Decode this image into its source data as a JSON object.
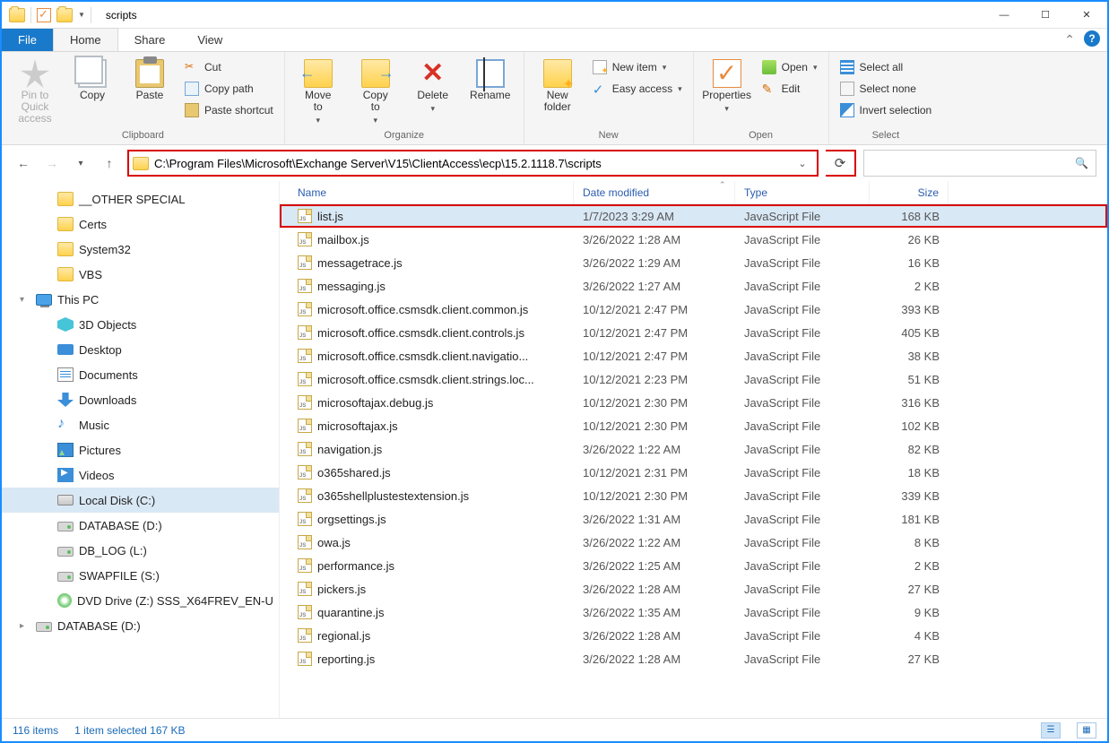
{
  "title": "scripts",
  "tabs": {
    "file": "File",
    "home": "Home",
    "share": "Share",
    "view": "View"
  },
  "ribbon": {
    "clipboard": {
      "label": "Clipboard",
      "pin": "Pin to Quick\naccess",
      "copy": "Copy",
      "paste": "Paste",
      "cut": "Cut",
      "copypath": "Copy path",
      "pasteshortcut": "Paste shortcut"
    },
    "organize": {
      "label": "Organize",
      "moveto": "Move\nto",
      "copyto": "Copy\nto",
      "delete": "Delete",
      "rename": "Rename"
    },
    "new_": {
      "label": "New",
      "newfolder": "New\nfolder",
      "newitem": "New item",
      "easyaccess": "Easy access"
    },
    "open": {
      "label": "Open",
      "properties": "Properties",
      "open": "Open",
      "edit": "Edit"
    },
    "select": {
      "label": "Select",
      "all": "Select all",
      "none": "Select none",
      "invert": "Invert selection"
    }
  },
  "address": "C:\\Program Files\\Microsoft\\Exchange Server\\V15\\ClientAccess\\ecp\\15.2.1118.7\\scripts",
  "tree": {
    "items": [
      {
        "kind": "folder",
        "lvl": 1,
        "label": "__OTHER SPECIAL"
      },
      {
        "kind": "folder",
        "lvl": 1,
        "label": "Certs"
      },
      {
        "kind": "folder",
        "lvl": 1,
        "label": "System32"
      },
      {
        "kind": "folder",
        "lvl": 1,
        "label": "VBS"
      },
      {
        "kind": "pc",
        "lvl": 0,
        "label": "This PC",
        "exp": "▾"
      },
      {
        "kind": "obj3d",
        "lvl": 1,
        "label": "3D Objects"
      },
      {
        "kind": "desktop",
        "lvl": 1,
        "label": "Desktop"
      },
      {
        "kind": "docs",
        "lvl": 1,
        "label": "Documents"
      },
      {
        "kind": "down",
        "lvl": 1,
        "label": "Downloads"
      },
      {
        "kind": "music",
        "lvl": 1,
        "label": "Music"
      },
      {
        "kind": "pics",
        "lvl": 1,
        "label": "Pictures"
      },
      {
        "kind": "vids",
        "lvl": 1,
        "label": "Videos"
      },
      {
        "kind": "hdd",
        "lvl": 1,
        "label": "Local Disk (C:)",
        "sel": true
      },
      {
        "kind": "drive",
        "lvl": 1,
        "label": "DATABASE (D:)"
      },
      {
        "kind": "drive",
        "lvl": 1,
        "label": "DB_LOG (L:)"
      },
      {
        "kind": "drive",
        "lvl": 1,
        "label": "SWAPFILE (S:)"
      },
      {
        "kind": "disc",
        "lvl": 1,
        "label": "DVD Drive (Z:) SSS_X64FREV_EN-U"
      },
      {
        "kind": "drive",
        "lvl": 0,
        "label": "DATABASE (D:)",
        "exp": "▸"
      }
    ]
  },
  "columns": {
    "name": "Name",
    "date": "Date modified",
    "type": "Type",
    "size": "Size"
  },
  "files": [
    {
      "name": "list.js",
      "date": "1/7/2023 3:29 AM",
      "type": "JavaScript File",
      "size": "168 KB",
      "sel": true,
      "hl": true
    },
    {
      "name": "mailbox.js",
      "date": "3/26/2022 1:28 AM",
      "type": "JavaScript File",
      "size": "26 KB"
    },
    {
      "name": "messagetrace.js",
      "date": "3/26/2022 1:29 AM",
      "type": "JavaScript File",
      "size": "16 KB"
    },
    {
      "name": "messaging.js",
      "date": "3/26/2022 1:27 AM",
      "type": "JavaScript File",
      "size": "2 KB"
    },
    {
      "name": "microsoft.office.csmsdk.client.common.js",
      "date": "10/12/2021 2:47 PM",
      "type": "JavaScript File",
      "size": "393 KB"
    },
    {
      "name": "microsoft.office.csmsdk.client.controls.js",
      "date": "10/12/2021 2:47 PM",
      "type": "JavaScript File",
      "size": "405 KB"
    },
    {
      "name": "microsoft.office.csmsdk.client.navigatio...",
      "date": "10/12/2021 2:47 PM",
      "type": "JavaScript File",
      "size": "38 KB"
    },
    {
      "name": "microsoft.office.csmsdk.client.strings.loc...",
      "date": "10/12/2021 2:23 PM",
      "type": "JavaScript File",
      "size": "51 KB"
    },
    {
      "name": "microsoftajax.debug.js",
      "date": "10/12/2021 2:30 PM",
      "type": "JavaScript File",
      "size": "316 KB"
    },
    {
      "name": "microsoftajax.js",
      "date": "10/12/2021 2:30 PM",
      "type": "JavaScript File",
      "size": "102 KB"
    },
    {
      "name": "navigation.js",
      "date": "3/26/2022 1:22 AM",
      "type": "JavaScript File",
      "size": "82 KB"
    },
    {
      "name": "o365shared.js",
      "date": "10/12/2021 2:31 PM",
      "type": "JavaScript File",
      "size": "18 KB"
    },
    {
      "name": "o365shellplustestextension.js",
      "date": "10/12/2021 2:30 PM",
      "type": "JavaScript File",
      "size": "339 KB"
    },
    {
      "name": "orgsettings.js",
      "date": "3/26/2022 1:31 AM",
      "type": "JavaScript File",
      "size": "181 KB"
    },
    {
      "name": "owa.js",
      "date": "3/26/2022 1:22 AM",
      "type": "JavaScript File",
      "size": "8 KB"
    },
    {
      "name": "performance.js",
      "date": "3/26/2022 1:25 AM",
      "type": "JavaScript File",
      "size": "2 KB"
    },
    {
      "name": "pickers.js",
      "date": "3/26/2022 1:28 AM",
      "type": "JavaScript File",
      "size": "27 KB"
    },
    {
      "name": "quarantine.js",
      "date": "3/26/2022 1:35 AM",
      "type": "JavaScript File",
      "size": "9 KB"
    },
    {
      "name": "regional.js",
      "date": "3/26/2022 1:28 AM",
      "type": "JavaScript File",
      "size": "4 KB"
    },
    {
      "name": "reporting.js",
      "date": "3/26/2022 1:28 AM",
      "type": "JavaScript File",
      "size": "27 KB"
    }
  ],
  "status": {
    "count": "116 items",
    "sel": "1 item selected  167 KB"
  }
}
